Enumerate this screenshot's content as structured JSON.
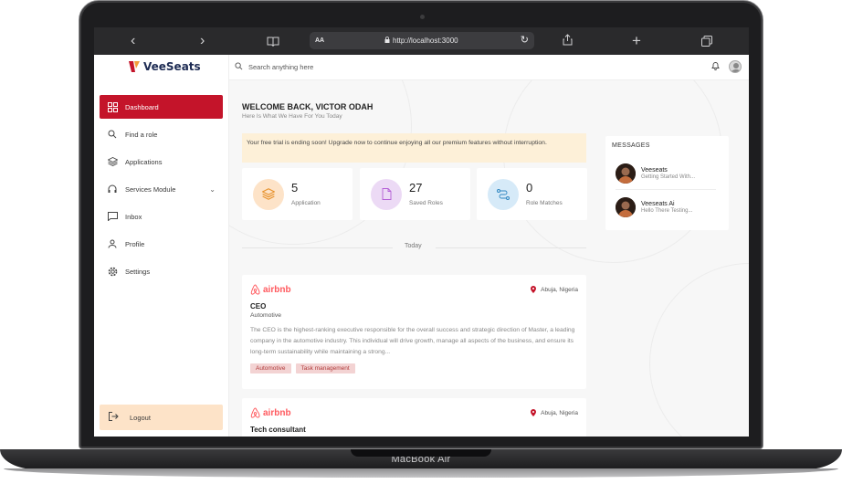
{
  "device": {
    "label": "MacBook Air"
  },
  "browser": {
    "text_size_label": "AA",
    "url": "http://localhost:3000"
  },
  "brand": {
    "name": "VeeSeats",
    "accent": "#c4142a"
  },
  "sidebar": {
    "items": [
      {
        "label": "Dashboard",
        "icon": "dashboard-icon",
        "active": true
      },
      {
        "label": "Find a role",
        "icon": "search-icon"
      },
      {
        "label": "Applications",
        "icon": "layers-icon"
      },
      {
        "label": "Services Module",
        "icon": "headset-icon",
        "has_chevron": true
      },
      {
        "label": "Inbox",
        "icon": "inbox-icon"
      },
      {
        "label": "Profile",
        "icon": "user-icon"
      },
      {
        "label": "Settings",
        "icon": "gear-icon"
      }
    ],
    "logout_label": "Logout"
  },
  "topbar": {
    "search_placeholder": "Search anything here"
  },
  "welcome": {
    "title": "WELCOME BACK, VICTOR ODAH",
    "subtitle": "Here Is What We Have For You Today"
  },
  "trial_banner": "Your free trial is ending soon! Upgrade now to continue enjoying all our premium features without interruption.",
  "stats": [
    {
      "value": "5",
      "label": "Application",
      "icon": "layers-icon",
      "color": "#fde3c8"
    },
    {
      "value": "27",
      "label": "Saved Roles",
      "icon": "file-icon",
      "color": "#ecdaf5"
    },
    {
      "value": "0",
      "label": "Role Matches",
      "icon": "route-icon",
      "color": "#d6eaf8"
    }
  ],
  "feed_divider": "Today",
  "jobs": [
    {
      "company": "airbnb",
      "location": "Abuja, Nigeria",
      "role": "CEO",
      "category": "Automotive",
      "description": "The CEO is the highest-ranking executive responsible for the overall success and strategic direction of Master, a leading company in the automotive industry. This individual will drive growth, manage all aspects of the business, and ensure its long-term sustainability while maintaining a strong...",
      "tags": [
        "Automotive",
        "Task management"
      ]
    },
    {
      "company": "airbnb",
      "location": "Abuja, Nigeria",
      "role": "Tech consultant"
    }
  ],
  "messages": {
    "title": "MESSAGES",
    "items": [
      {
        "name": "Veeseats",
        "preview": "Getting Started With..."
      },
      {
        "name": "Veeseats Ai",
        "preview": "Hello There Testing..."
      }
    ]
  }
}
